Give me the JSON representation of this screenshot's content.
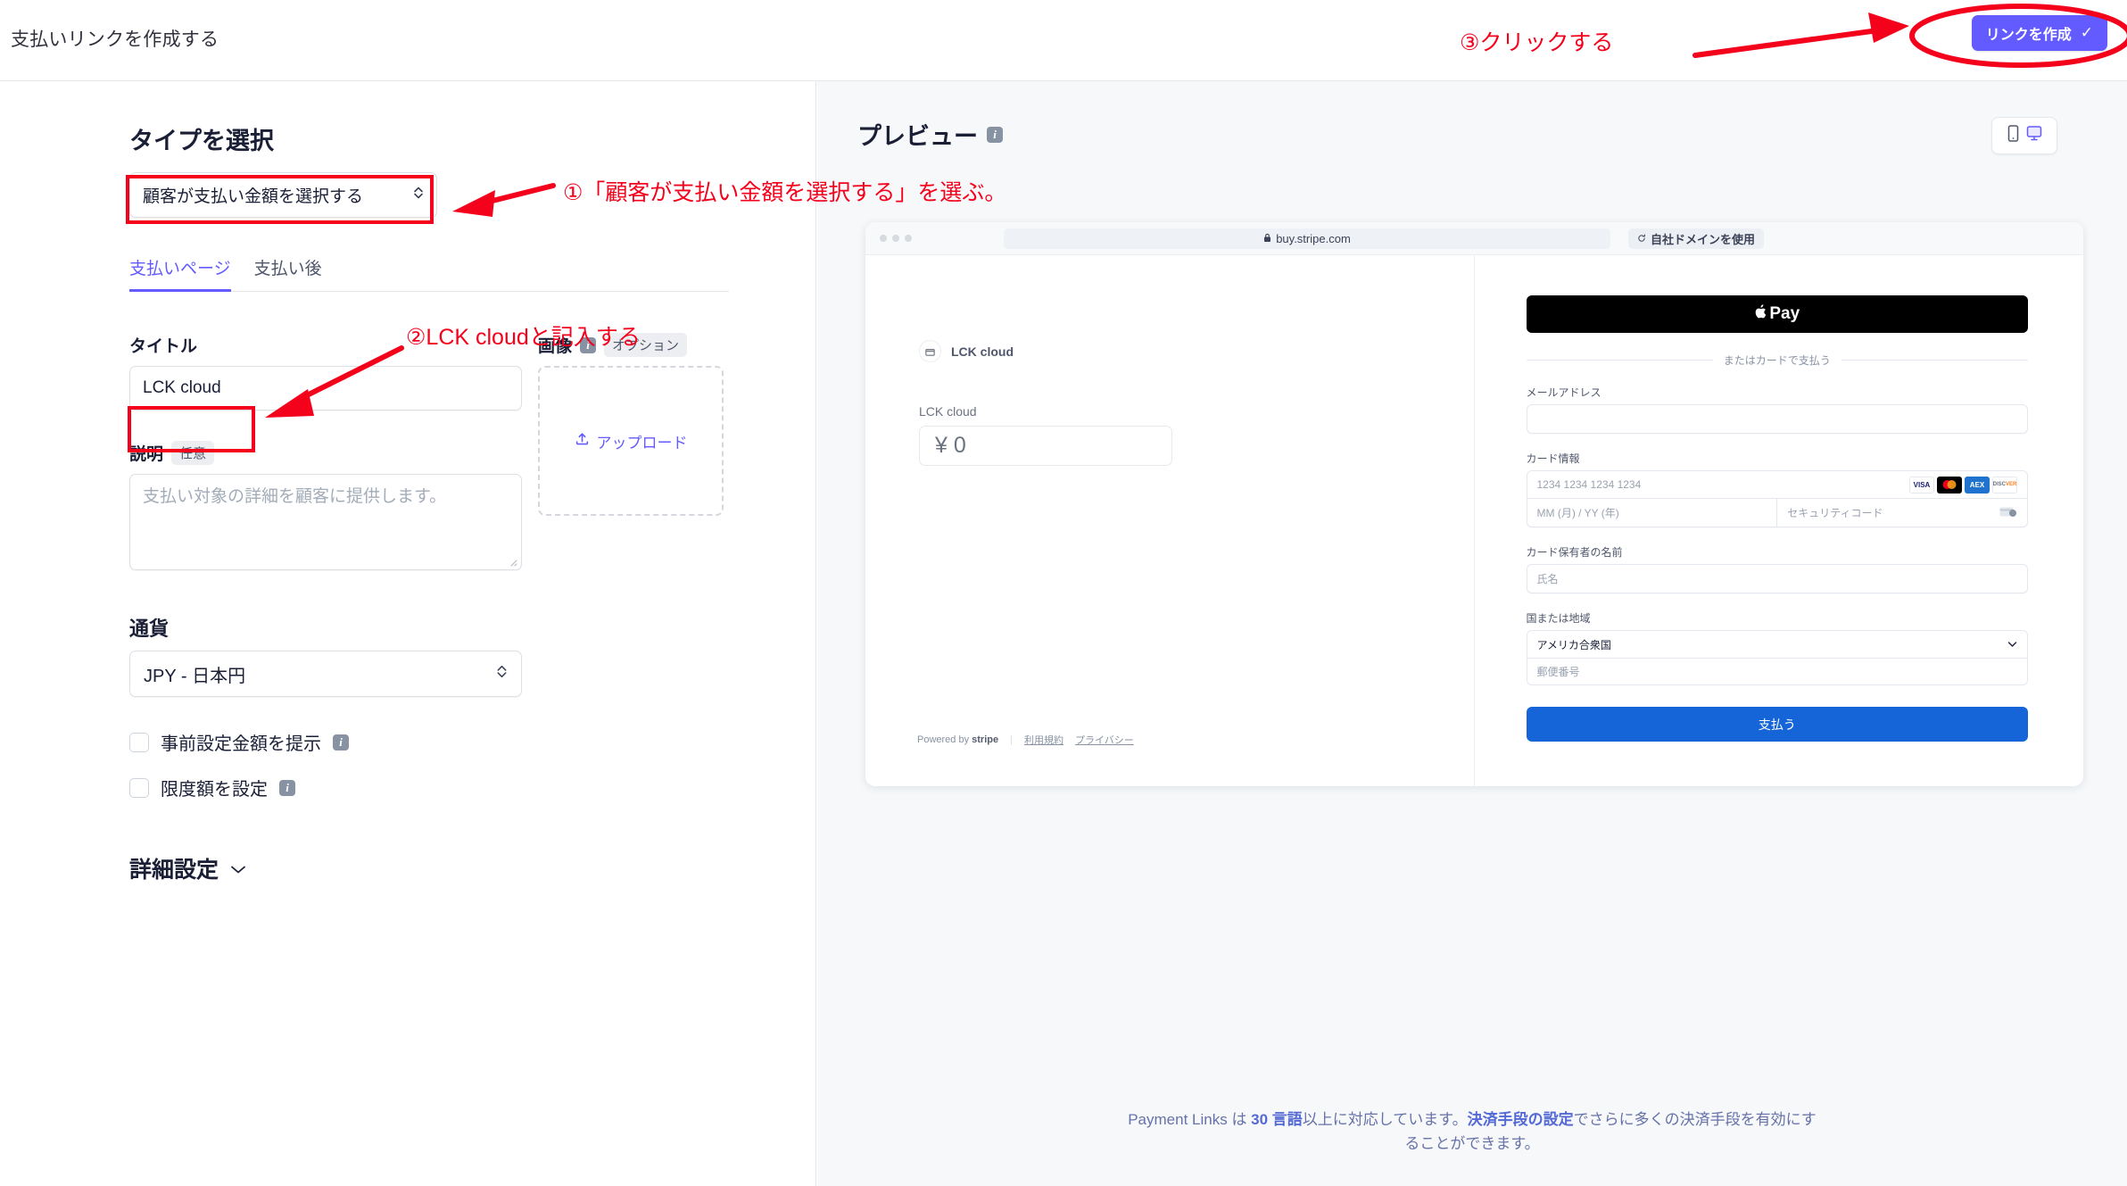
{
  "header": {
    "title": "支払いリンクを作成する",
    "create_button": "リンクを作成",
    "create_button_check": "✓"
  },
  "annotations": {
    "step1": "①「顧客が支払い金額を選択する」を選ぶ。",
    "step2": "②LCK cloudと記入する",
    "step3": "③クリックする",
    "color": "#f4021c"
  },
  "left_panel": {
    "section_title": "タイプを選択",
    "type_select_value": "顧客が支払い金額を選択する",
    "type_select_caret": "⌃⌄",
    "tabs": [
      {
        "label": "支払いページ",
        "active": true
      },
      {
        "label": "支払い後",
        "active": false
      }
    ],
    "title_field": {
      "label": "タイトル",
      "value": "LCK cloud"
    },
    "image_field": {
      "label": "画像",
      "badge": "オプション",
      "upload_label": "アップロード",
      "upload_icon": "upload-icon"
    },
    "description_field": {
      "label": "説明",
      "badge": "任意",
      "placeholder": "支払い対象の詳細を顧客に提供します。"
    },
    "currency_field": {
      "label": "通貨",
      "value": "JPY - 日本円"
    },
    "checkboxes": [
      {
        "label": "事前設定金額を提示",
        "checked": false
      },
      {
        "label": "限度額を設定",
        "checked": false
      }
    ],
    "advanced": "詳細設定"
  },
  "preview": {
    "title": "プレビュー",
    "device_toggle": {
      "mobile": "mobile-icon",
      "desktop": "desktop-icon",
      "active": "desktop"
    },
    "browser": {
      "url": "buy.stripe.com",
      "lock_icon": "lock-icon",
      "domain_button": "自社ドメインを使用"
    },
    "left_pane": {
      "merchant_name": "LCK cloud",
      "amount_label": "LCK cloud",
      "amount_value": "¥ 0",
      "powered_by_prefix": "Powered by",
      "powered_by_brand": "stripe",
      "terms_link": "利用規約",
      "privacy_link": "プライバシー"
    },
    "right_pane": {
      "apple_pay": "Pay",
      "or_divider": "またはカードで支払う",
      "email_label": "メールアドレス",
      "email_value": "",
      "card_label": "カード情報",
      "card_number_placeholder": "1234 1234 1234 1234",
      "card_expiry_placeholder": "MM (月) / YY (年)",
      "card_cvc_placeholder": "セキュリティコード",
      "card_brands": [
        "VISA",
        "Mastercard",
        "Amex",
        "Discover"
      ],
      "name_label": "カード保有者の名前",
      "name_placeholder": "氏名",
      "country_label": "国または地域",
      "country_value": "アメリカ合衆国",
      "zip_placeholder": "郵便番号",
      "pay_button": "支払う"
    }
  },
  "footer": {
    "text_1": "Payment Links は ",
    "highlight_1": "30 言語",
    "text_2": "以上に対応しています。",
    "link": "決済手段の設定",
    "text_3": "でさらに多くの決済手段を有効にすることができます。"
  }
}
